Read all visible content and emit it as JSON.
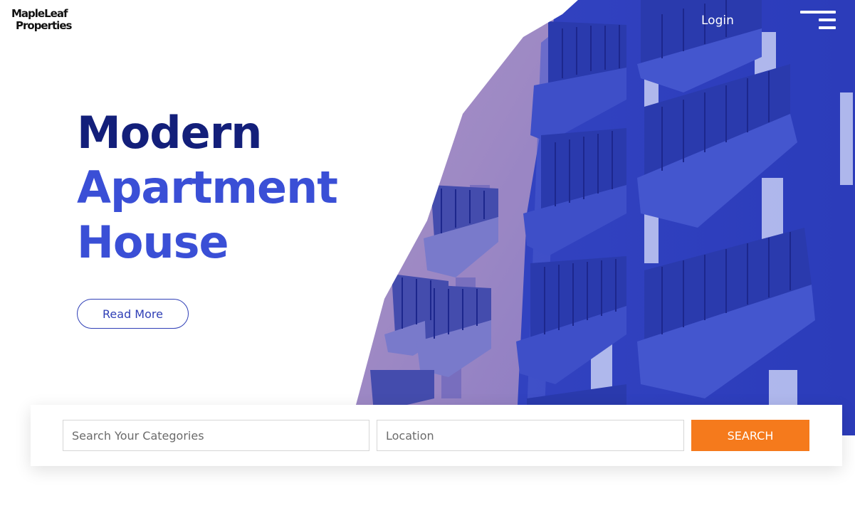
{
  "brand": {
    "logo_line1": "MapleLeaf",
    "logo_line2": "Properties"
  },
  "nav": {
    "login_label": "Login",
    "menu_icon": "hamburger-menu-icon"
  },
  "hero": {
    "title_line1": "Modern",
    "title_line2": "Apartment",
    "title_line3": "House",
    "read_more_label": "Read More",
    "image_description_icon": "apartment-building-image"
  },
  "search": {
    "category_placeholder": "Search Your Categories",
    "category_value": "",
    "location_placeholder": "Location",
    "location_value": "",
    "button_label": "SEARCH"
  },
  "colors": {
    "title_dark": "#131f7a",
    "title_accent": "#3a4fd6",
    "image_tint": "#3848c4",
    "search_button": "#f57a1c"
  }
}
